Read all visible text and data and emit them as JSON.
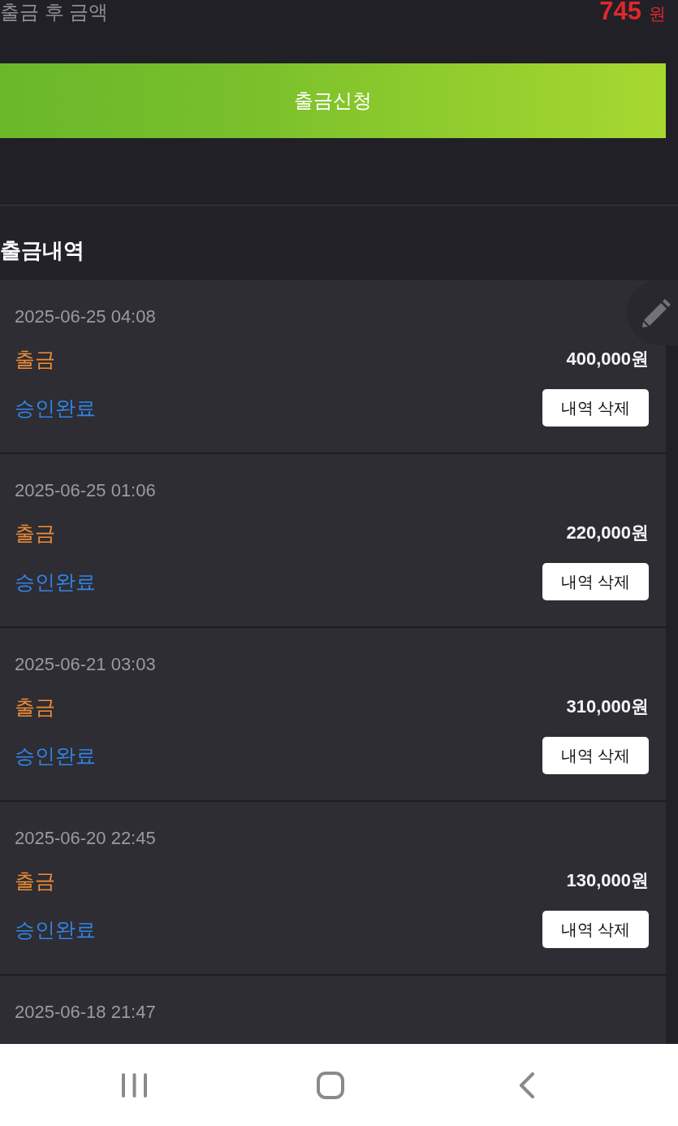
{
  "balance_after": {
    "label": "출금 후 금액",
    "amount": "745",
    "unit": "원"
  },
  "withdraw_button": {
    "label": "출금신청"
  },
  "history": {
    "title": "출금내역",
    "entries": [
      {
        "date": "2025-06-25 04:08",
        "type": "출금",
        "amount": "400,000원",
        "status": "승인완료",
        "action": "내역 삭제"
      },
      {
        "date": "2025-06-25 01:06",
        "type": "출금",
        "amount": "220,000원",
        "status": "승인완료",
        "action": "내역 삭제"
      },
      {
        "date": "2025-06-21 03:03",
        "type": "출금",
        "amount": "310,000원",
        "status": "승인완료",
        "action": "내역 삭제"
      },
      {
        "date": "2025-06-20 22:45",
        "type": "출금",
        "amount": "130,000원",
        "status": "승인완료",
        "action": "내역 삭제"
      },
      {
        "date": "2025-06-18 21:47"
      }
    ]
  }
}
